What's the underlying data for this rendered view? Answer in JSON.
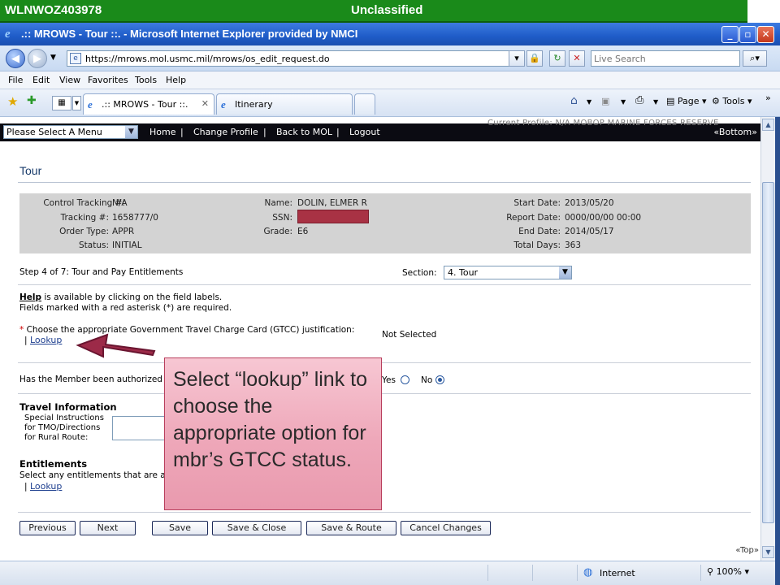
{
  "classification_bar": {
    "hostname": "WLNWOZ403978",
    "label": "Unclassified"
  },
  "window": {
    "title": ".:: MROWS - Tour ::. - Microsoft Internet Explorer provided by NMCI"
  },
  "address_bar": {
    "url": "https://mrows.mol.usmc.mil/mrows/os_edit_request.do",
    "search_placeholder": "Live Search"
  },
  "menu_bar": [
    "File",
    "Edit",
    "View",
    "Favorites",
    "Tools",
    "Help"
  ],
  "tabs": [
    {
      "label": ".:: MROWS - Tour ::."
    },
    {
      "label": "Itinerary"
    }
  ],
  "command_bar": {
    "page": "Page",
    "tools": "Tools",
    "more": "»"
  },
  "app_nav": {
    "faded_text": "Current Profile: N/A    MOBOP    MARINE FORCES RESERVE",
    "menu_select": "Please Select A Menu",
    "links": [
      "Home",
      "Change Profile",
      "Back to MOL",
      "Logout"
    ],
    "bottom_link": "«Bottom»"
  },
  "page": {
    "title": "Tour",
    "info": {
      "control_tracking_label": "Control Tracking #:",
      "control_tracking": "N/A",
      "tracking_label": "Tracking #:",
      "tracking": "1658777/0",
      "order_type_label": "Order Type:",
      "order_type": "APPR",
      "status_label": "Status:",
      "status": "INITIAL",
      "name_label": "Name:",
      "name": "DOLIN, ELMER R",
      "ssn_label": "SSN:",
      "grade_label": "Grade:",
      "grade": "E6",
      "start_date_label": "Start Date:",
      "start_date": "2013/05/20",
      "report_date_label": "Report Date:",
      "report_date": "0000/00/00 00:00",
      "end_date_label": "End Date:",
      "end_date": "2014/05/17",
      "total_days_label": "Total Days:",
      "total_days": "363"
    },
    "step": "Step 4 of 7: Tour and Pay Entitlements",
    "section_label": "Section:",
    "section_value": "4. Tour",
    "help_word": "Help",
    "help_text": " is available by clicking on the field labels.",
    "required_text": "Fields marked with a red asterisk (*) are required.",
    "gtcc_asterisk": "*",
    "gtcc_question": " Choose the appropriate Government Travel Charge Card (GTCC) justification:",
    "pipe": "|",
    "lookup": "Lookup",
    "not_selected": "Not Selected",
    "authorized_question": "Has the Member been authorized",
    "yes": "Yes",
    "no": "No",
    "travel_info_heading": "Travel Information",
    "special_instructions": [
      "Special Instructions",
      "for TMO/Directions",
      "for Rural Route:"
    ],
    "entitlements_heading": "Entitlements",
    "entitlements_text": "Select any entitlements that are a",
    "buttons": [
      "Previous",
      "Next",
      "Save",
      "Save & Close",
      "Save & Route",
      "Cancel Changes"
    ],
    "top_link": "«Top»"
  },
  "callout": {
    "text": "Select “lookup” link to choose the appropriate option for mbr’s GTCC status."
  },
  "status_bar": {
    "zone": "Internet",
    "zoom": "100%"
  },
  "colors": {
    "classification_green": "#1a8a1a",
    "callout_pink": "#eea7b9",
    "arrow": "#9c2a48",
    "app_nav_bg": "#0b0b12"
  }
}
